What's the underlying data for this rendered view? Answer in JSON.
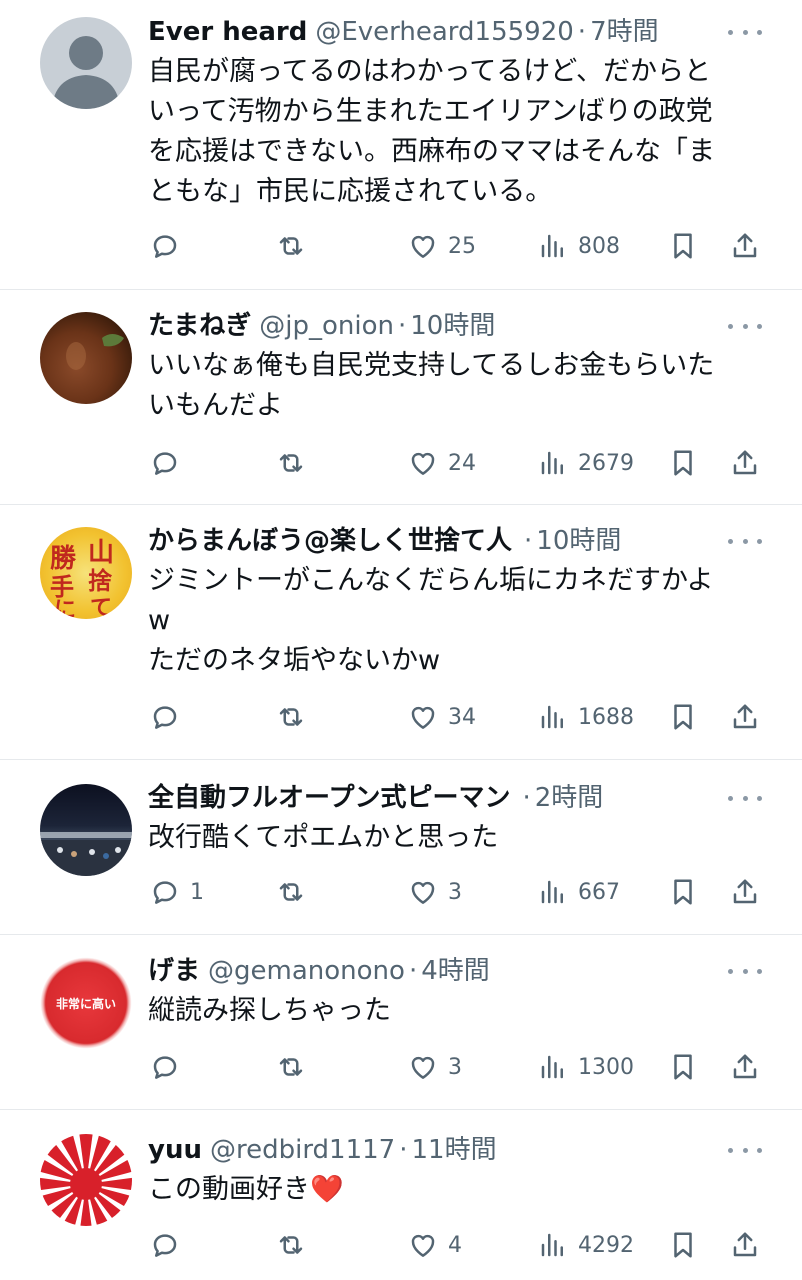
{
  "colors": {
    "text": "#0f1419",
    "secondary": "#536471",
    "border": "#e6e9ec",
    "heart": "#e8243c"
  },
  "tweets": [
    {
      "name": "Ever heard",
      "handle": "@Everheard155920",
      "dot": "·",
      "time": "7時間",
      "text": "自民が腐ってるのはわかってるけど、だからと\nいって汚物から生まれたエイリアンばりの政党\nを応援はできない。西麻布のママはそんな「ま\nともな」市民に応援されている。",
      "replies": "",
      "retweets": "",
      "likes": "25",
      "views": "808"
    },
    {
      "name": "たまねぎ",
      "handle": "@jp_onion",
      "dot": "·",
      "time": "10時間",
      "text": "いいなぁ俺も自民党支持してるしお金もらいた\nいもんだよ",
      "replies": "",
      "retweets": "",
      "likes": "24",
      "views": "2679"
    },
    {
      "name": "からまんぼう@楽しく世捨て人",
      "handle": "",
      "dot": "·",
      "time": "10時間",
      "text": "ジミントーがこんなくだらん垢にカネだすかよ\nw\nただのネタ垢やないかw",
      "replies": "",
      "retweets": "",
      "likes": "34",
      "views": "1688",
      "avatar_chars": [
        "勝",
        "山",
        "手",
        "捨",
        "に",
        "て"
      ]
    },
    {
      "name": "全自動フルオープン式ピーマン",
      "handle": "",
      "dot": "·",
      "time": "2時間",
      "text": "改行酷くてポエムかと思った",
      "replies": "1",
      "retweets": "",
      "likes": "3",
      "views": "667"
    },
    {
      "name": "げま",
      "handle": "@gemanonono",
      "dot": "·",
      "time": "4時間",
      "text": "縦読み探しちゃった",
      "replies": "",
      "retweets": "",
      "likes": "3",
      "views": "1300",
      "avatar_text": "非常に高い"
    },
    {
      "name": "yuu",
      "handle": "@redbird1117",
      "dot": "·",
      "time": "11時間",
      "text": "この動画好き",
      "emoji": "❤️",
      "replies": "",
      "retweets": "",
      "likes": "4",
      "views": "4292"
    }
  ]
}
